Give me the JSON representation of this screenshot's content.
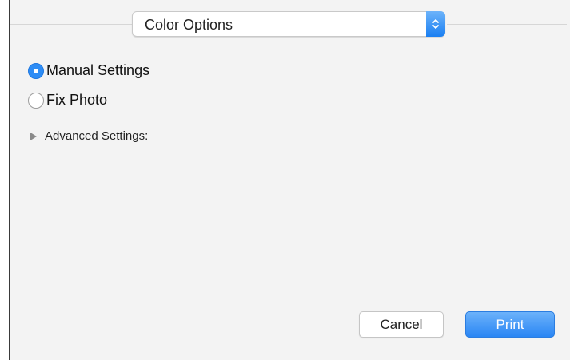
{
  "dropdown": {
    "selected": "Color Options"
  },
  "options": [
    {
      "label": "Manual Settings",
      "selected": true
    },
    {
      "label": "Fix Photo",
      "selected": false
    }
  ],
  "advanced": {
    "label": "Advanced Settings:",
    "expanded": false
  },
  "buttons": {
    "cancel": "Cancel",
    "print": "Print"
  },
  "colors": {
    "accent": "#2d8cf5",
    "panel_bg": "#f3f3f3"
  },
  "icons": {
    "stepper": "up-down-chevron-icon",
    "disclosure": "disclosure-triangle-icon"
  }
}
